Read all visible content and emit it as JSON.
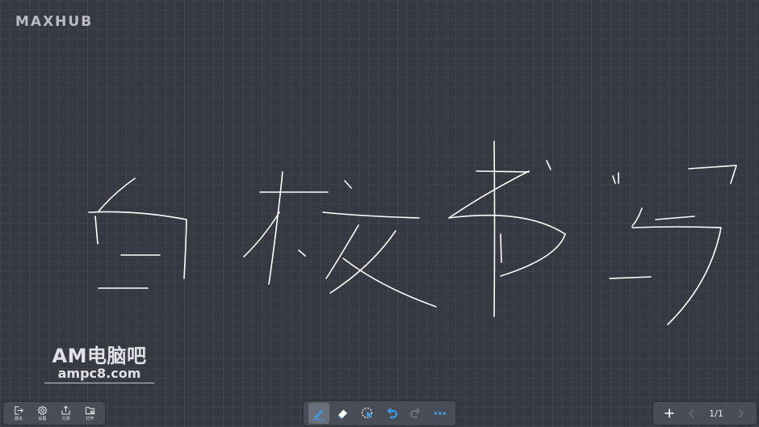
{
  "app": {
    "logo": "MAXHUB"
  },
  "watermark": {
    "title": "AM电脑吧",
    "site": "ampc8.com"
  },
  "left_toolbar": {
    "items": [
      {
        "label": "退出",
        "icon": "exit-icon"
      },
      {
        "label": "设置",
        "icon": "gear-icon"
      },
      {
        "label": "分享",
        "icon": "share-icon"
      },
      {
        "label": "打开",
        "icon": "folder-icon"
      }
    ]
  },
  "center_toolbar": {
    "active_tool": "pen",
    "accent_color": "#3a9be8",
    "items": [
      "pen-icon",
      "eraser-icon",
      "lasso-select-icon",
      "undo-icon",
      "redo-icon",
      "more-icon"
    ]
  },
  "right_toolbar": {
    "page_indicator": "1/1"
  },
  "colors": {
    "background": "#353941",
    "stroke": "#ffffff",
    "toolbar": "#484d56"
  }
}
